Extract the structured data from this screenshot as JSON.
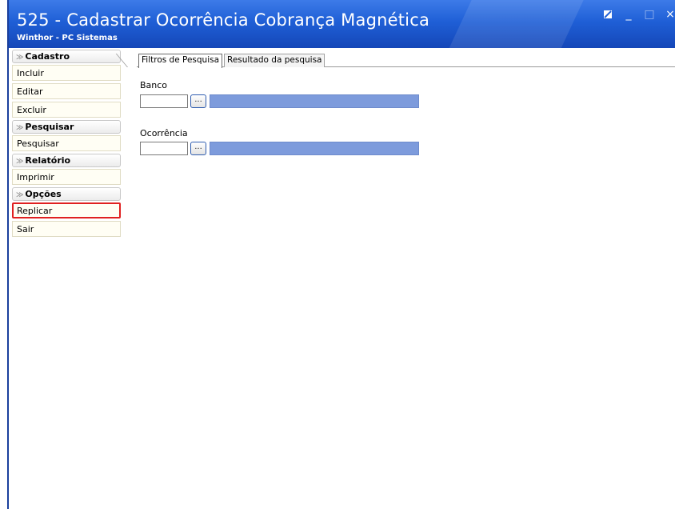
{
  "window": {
    "title": "525 - Cadastrar Ocorrência Cobrança Magnética",
    "subtitle": "Winthor - PC Sistemas",
    "controls": {
      "restore_icon": "restore-icon",
      "minimize_symbol": "_",
      "maximize_symbol": "□",
      "close_symbol": "×"
    }
  },
  "sidebar": {
    "groups": [
      {
        "title": "Cadastro",
        "items": [
          {
            "label": "Incluir"
          },
          {
            "label": "Editar"
          },
          {
            "label": "Excluir"
          }
        ]
      },
      {
        "title": "Pesquisar",
        "items": [
          {
            "label": "Pesquisar"
          }
        ]
      },
      {
        "title": "Relatório",
        "items": [
          {
            "label": "Imprimir"
          }
        ]
      },
      {
        "title": "Opções",
        "items": [
          {
            "label": "Replicar",
            "highlighted": true
          },
          {
            "label": "Sair"
          }
        ]
      }
    ],
    "chevron_symbol": "≫"
  },
  "tabs": [
    {
      "label": "Filtros de Pesquisa",
      "active": true
    },
    {
      "label": "Resultado da pesquisa",
      "active": false
    }
  ],
  "filters": {
    "banco": {
      "label": "Banco",
      "code_value": "",
      "browse_label": "...",
      "description": ""
    },
    "ocorrencia": {
      "label": "Ocorrência",
      "code_value": "",
      "browse_label": "...",
      "description": ""
    }
  },
  "colors": {
    "titlebar": "#1f5fd6",
    "description_field": "#7d9bdc",
    "highlight_border": "#e02020",
    "sidebar_item_bg": "#fffef4"
  }
}
